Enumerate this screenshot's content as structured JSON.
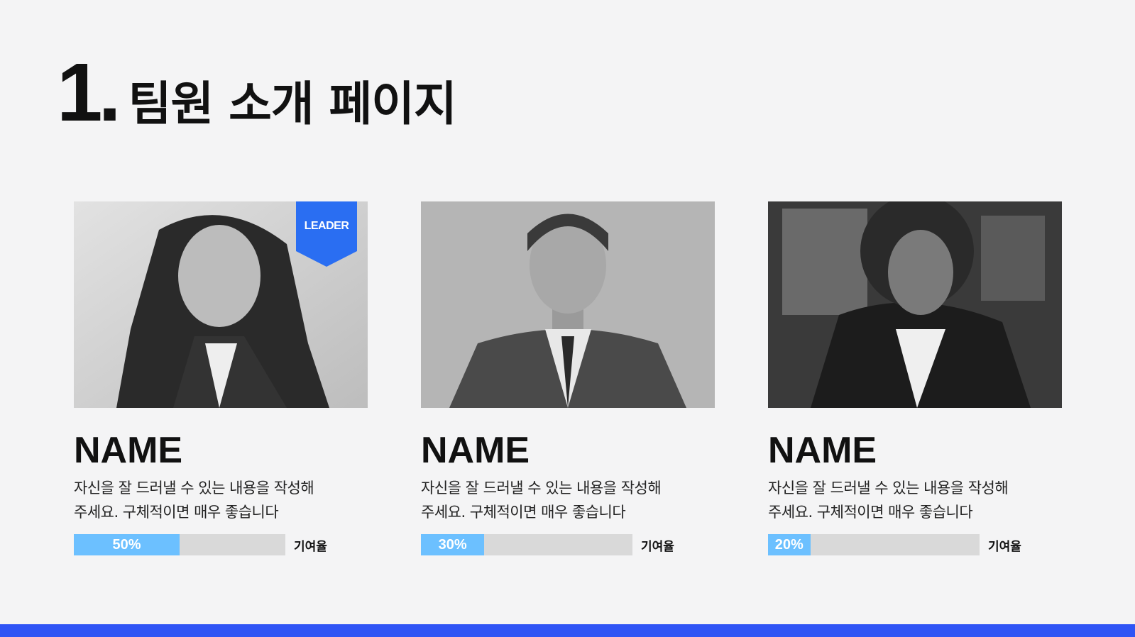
{
  "page": {
    "title_number": "1.",
    "title_text": "팀원 소개 페이지"
  },
  "members": [
    {
      "badge": "LEADER",
      "name": "NAME",
      "desc_line1": "자신을 잘 드러낼 수 있는 내용을 작성해",
      "desc_line2": "주세요. 구체적이면 매우 좋습니다",
      "contribution": 50,
      "contribution_text": "50%",
      "contribution_label": "기여율"
    },
    {
      "name": "NAME",
      "desc_line1": "자신을 잘 드러낼 수 있는 내용을 작성해",
      "desc_line2": "주세요. 구체적이면 매우 좋습니다",
      "contribution": 30,
      "contribution_text": "30%",
      "contribution_label": "기여율"
    },
    {
      "name": "NAME",
      "desc_line1": "자신을 잘 드러낼 수 있는 내용을 작성해",
      "desc_line2": "주세요. 구체적이면 매우 좋습니다",
      "contribution": 20,
      "contribution_text": "20%",
      "contribution_label": "기여율"
    }
  ],
  "colors": {
    "accent_blue": "#2a6ef2",
    "progress_fill": "#6cc0ff",
    "progress_track": "#d9d9d9",
    "footer_bar": "#2f54f5"
  }
}
